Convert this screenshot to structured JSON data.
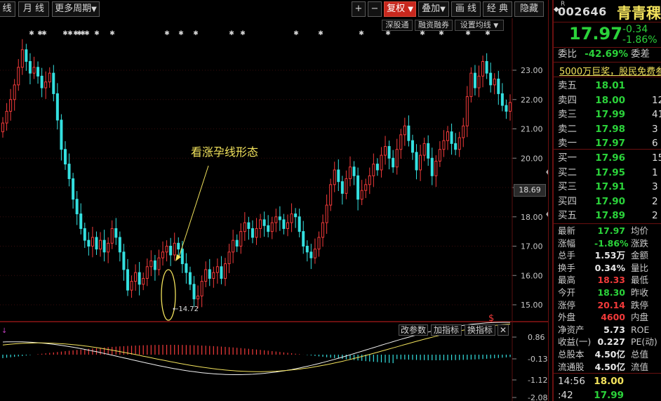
{
  "toolbar": {
    "left_buttons": [
      "线",
      "月 线",
      "更多周期"
    ],
    "right_buttons": [
      "+",
      "−",
      "复权",
      "叠加",
      "画 线",
      "经 典",
      "隐藏"
    ],
    "sub_buttons": [
      "深股通",
      "融资融券",
      "设置均线"
    ]
  },
  "quote": {
    "code": "002646",
    "name": "青青稞",
    "price": "17.97",
    "change": "-0.34",
    "change_pct": "-1.86%",
    "weibi_label": "委比",
    "weibi_value": "-42.69%",
    "weicha_label": "委差",
    "ad_text": "5000万巨奖，股民免费参"
  },
  "order_book": {
    "sell": [
      {
        "label": "卖五",
        "price": "18.01",
        "vol": ""
      },
      {
        "label": "卖四",
        "price": "18.00",
        "vol": "12"
      },
      {
        "label": "卖三",
        "price": "17.99",
        "vol": "41"
      },
      {
        "label": "卖二",
        "price": "17.98",
        "vol": "3"
      },
      {
        "label": "卖一",
        "price": "17.97",
        "vol": "6"
      }
    ],
    "buy": [
      {
        "label": "买一",
        "price": "17.96",
        "vol": "15"
      },
      {
        "label": "买二",
        "price": "17.95",
        "vol": "1"
      },
      {
        "label": "买三",
        "price": "17.91",
        "vol": "3"
      },
      {
        "label": "买四",
        "price": "17.90",
        "vol": "2"
      },
      {
        "label": "买五",
        "price": "17.89",
        "vol": "2"
      }
    ]
  },
  "stats": [
    {
      "label": "最新",
      "value": "17.97",
      "color": "green",
      "label2": "均价"
    },
    {
      "label": "涨幅",
      "value": "-1.86%",
      "color": "green",
      "label2": "涨跌"
    },
    {
      "label": "总手",
      "value": "1.53万",
      "color": "white",
      "label2": "金额"
    },
    {
      "label": "换手",
      "value": "0.34%",
      "color": "white",
      "label2": "量比"
    },
    {
      "label": "最高",
      "value": "18.33",
      "color": "red",
      "label2": "最低"
    },
    {
      "label": "今开",
      "value": "18.30",
      "color": "green",
      "label2": "昨收"
    },
    {
      "label": "涨停",
      "value": "20.14",
      "color": "red",
      "label2": "跌停"
    },
    {
      "label": "外盘",
      "value": "4600",
      "color": "red",
      "label2": "内盘"
    },
    {
      "label": "净资产",
      "value": "5.73",
      "color": "white",
      "label2": "ROE"
    },
    {
      "label": "收益(一)",
      "value": "0.227",
      "color": "white",
      "label2": "PE(动)"
    },
    {
      "label": "总股本",
      "value": "4.50亿",
      "color": "white",
      "label2": "总值"
    },
    {
      "label": "流通股",
      "value": "4.50亿",
      "color": "white",
      "label2": "流值"
    }
  ],
  "ticks": [
    {
      "time": "14:56",
      "price": "18.00"
    },
    {
      "time": ":42",
      "price": "17.99"
    }
  ],
  "chart": {
    "price_axis": [
      "23.00",
      "22.00",
      "21.00",
      "20.00",
      "19.00",
      "18.00",
      "17.00",
      "16.00",
      "15.00"
    ],
    "current_price_tag": "18.69",
    "low_label": "←14.72",
    "annotation": "看涨孕线形态",
    "macd_axis": [
      "0.86",
      "-0.13",
      "-1.12",
      "-2.08"
    ],
    "macd_buttons": [
      "改参数",
      "加指标",
      "换指标",
      "✕"
    ],
    "dollar_mark": "$"
  },
  "colors": {
    "up": "#f23a3a",
    "down": "#34e0e0",
    "accent": "#c8281e",
    "macd_dif": "#f2f2f2",
    "macd_dea": "#f2e25c"
  }
}
